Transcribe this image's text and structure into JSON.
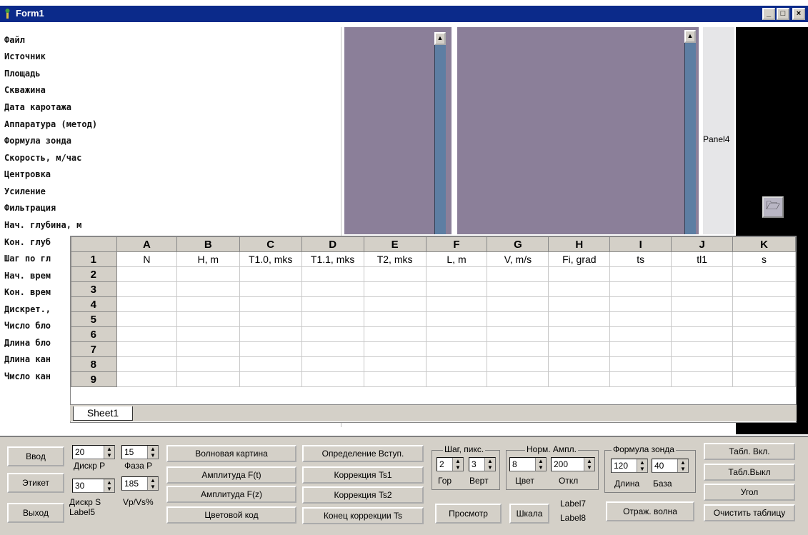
{
  "window": {
    "title": "Form1"
  },
  "controls": {
    "minimize": "_",
    "maximize": "□",
    "close": "×"
  },
  "info_list": [
    "Файл",
    "Источник",
    "Площадь",
    "Скважина",
    "Дата каротажа",
    "Аппаратура (метод)",
    "Формула зонда",
    "Скорость, м/час",
    "Центровка",
    "Усиление",
    "Фильтрация",
    "Нач. глубина, м",
    "Кон. глуб",
    "Шаг по гл",
    "Нач. врем",
    "Кон. врем",
    "Дискрет.,",
    "Число бло",
    "Длина бло",
    "Длина кан",
    "Чмсло кан"
  ],
  "panel4": {
    "label": "Panel4"
  },
  "sheet": {
    "columns": [
      "A",
      "B",
      "C",
      "D",
      "E",
      "F",
      "G",
      "H",
      "I",
      "J",
      "K"
    ],
    "row_numbers": [
      "1",
      "2",
      "3",
      "4",
      "5",
      "6",
      "7",
      "8",
      "9"
    ],
    "row1": [
      "N",
      "H, m",
      "T1.0, mks",
      "T1.1, mks",
      "T2, mks",
      "L, m",
      "V, m/s",
      "Fi, grad",
      "ts",
      "tl1",
      "s"
    ],
    "tab": "Sheet1"
  },
  "toolbar": {
    "vvod": "Ввод",
    "etiket": "Этикет",
    "vykhod": "Выход",
    "disk_p_value": "20",
    "disk_p_label": "Дискр Р",
    "faza_p_value": "15",
    "faza_p_label": "Фаза Р",
    "disk_s_value": "30",
    "disk_s_label": "Дискр S",
    "vpvs_value": "185",
    "vpvs_label": "Vp/Vs%",
    "label5": "Label5",
    "volnovaya": "Волновая картина",
    "ampl_t": "Амплитуда F(t)",
    "ampl_z": "Амплитуда F(z)",
    "color_code": "Цветовой код",
    "opred_vstup": "Определение Вступ.",
    "korr_ts1": "Коррекция Ts1",
    "korr_ts2": "Коррекция Ts2",
    "konets_korr": "Конец коррекции Ts",
    "shag_title": "Шаг, пикс.",
    "shag_gor_value": "2",
    "shag_vert_value": "3",
    "gor_label": "Гор",
    "vert_label": "Верт",
    "norm_title": "Норм. Ампл.",
    "norm_color_value": "8",
    "norm_otkl_value": "200",
    "tsvet_label": "Цвет",
    "otkl_label": "Откл",
    "formula_title": "Формула зонда",
    "dlina_value": "120",
    "baza_value": "40",
    "dlina_label": "Длина",
    "baza_label": "База",
    "prosmotr": "Просмотр",
    "shkala": "Шкала",
    "label7": "Label7",
    "label8": "Label8",
    "otrazh": "Отраж. волна",
    "tabl_vkl": "Табл. Вкл.",
    "tabl_vykl": "Табл.Выкл",
    "ugol": "Угол",
    "clear_table": "Очистить таблицу"
  }
}
